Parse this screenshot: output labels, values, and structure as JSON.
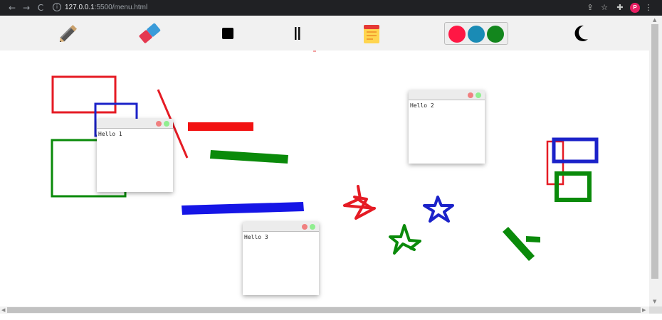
{
  "browser": {
    "back_icon": "arrow-left-icon",
    "forward_icon": "arrow-right-icon",
    "reload_icon": "reload-icon",
    "url_host": "127.0.0.1",
    "url_rest": ":5500/menu.html",
    "profile_initial": "P",
    "extension_icons": [
      "share-icon",
      "star-icon",
      "puzzle-icon"
    ]
  },
  "toolbar": {
    "tools": [
      "pencil",
      "eraser",
      "square",
      "pause",
      "sticky-note"
    ],
    "colors": [
      "#ff1744",
      "#1a8bb5",
      "#13861d"
    ],
    "theme_icon": "moon-icon"
  },
  "notes": [
    {
      "text": "Hello 1"
    },
    {
      "text": "Hello 2"
    },
    {
      "text": "Hello 3"
    }
  ]
}
